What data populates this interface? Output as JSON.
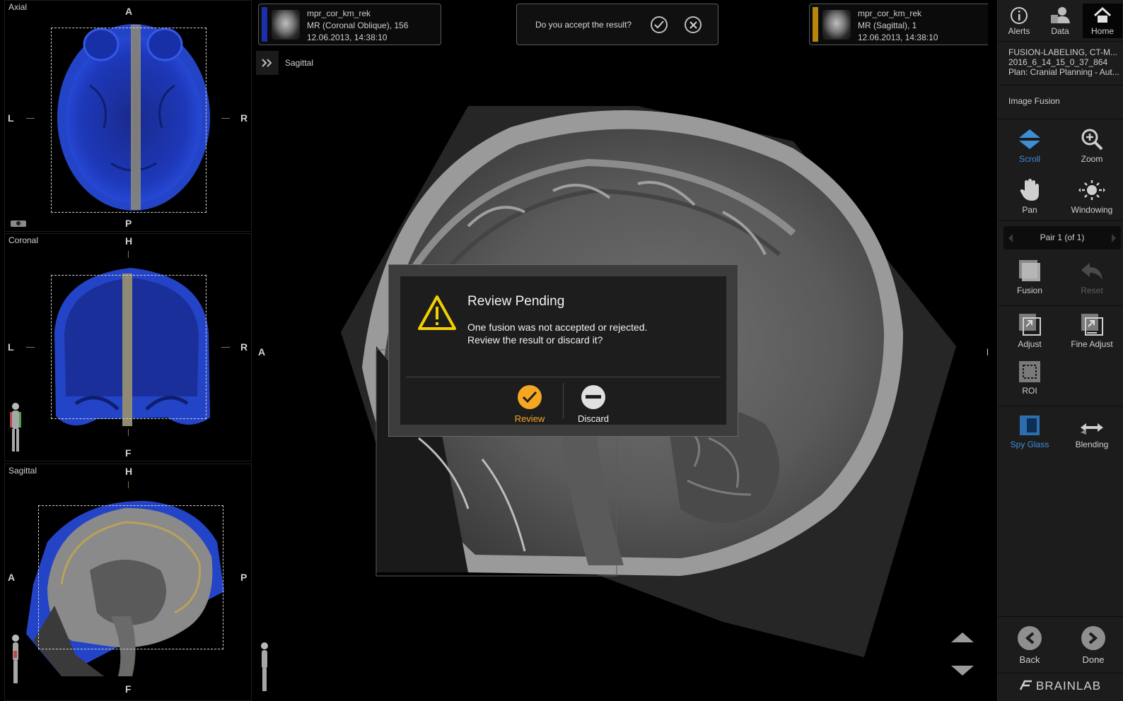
{
  "views": {
    "axial": {
      "title": "Axial",
      "top": "A",
      "bottom": "P",
      "left": "L",
      "right": "R"
    },
    "coronal": {
      "title": "Coronal",
      "top": "H",
      "bottom": "F",
      "left": "L",
      "right": "R"
    },
    "sagittal": {
      "title": "Sagittal",
      "top": "H",
      "bottom": "F",
      "left": "A",
      "right": "P"
    }
  },
  "main": {
    "title": "Sagittal",
    "left_orient": "A",
    "right_orient": "P",
    "study_left": {
      "name": "mpr_cor_km_rek",
      "series": "MR (Coronal Oblique), 156",
      "date": "12.06.2013, 14:38:10",
      "color": "#1b2fa8"
    },
    "study_right": {
      "name": "mpr_cor_km_rek",
      "series": "MR (Sagittal), 1",
      "date": "12.06.2013, 14:38:10",
      "color": "#b8860b"
    },
    "accept_question": "Do you accept the result?"
  },
  "dialog": {
    "title": "Review Pending",
    "line1": "One fusion was not accepted or rejected.",
    "line2": "Review the result or discard it?",
    "review_label": "Review",
    "discard_label": "Discard",
    "accent": "#f5a623"
  },
  "panel": {
    "top_buttons": {
      "alerts": "Alerts",
      "data": "Data",
      "home": "Home"
    },
    "info": {
      "line1": "FUSION-LABELING, CT-M...",
      "line2": "2016_6_14_15_0_37_864",
      "line3": "Plan: Cranial Planning - Aut..."
    },
    "section_title": "Image Fusion",
    "tools": {
      "scroll": "Scroll",
      "zoom": "Zoom",
      "pan": "Pan",
      "windowing": "Windowing",
      "fusion": "Fusion",
      "reset": "Reset",
      "adjust": "Adjust",
      "fine_adjust": "Fine Adjust",
      "roi": "ROI",
      "spy_glass": "Spy Glass",
      "blending": "Blending"
    },
    "pair": "Pair 1 (of 1)",
    "back": "Back",
    "done": "Done",
    "brand": "BRAINLAB",
    "active_color": "#3f8ed2"
  }
}
